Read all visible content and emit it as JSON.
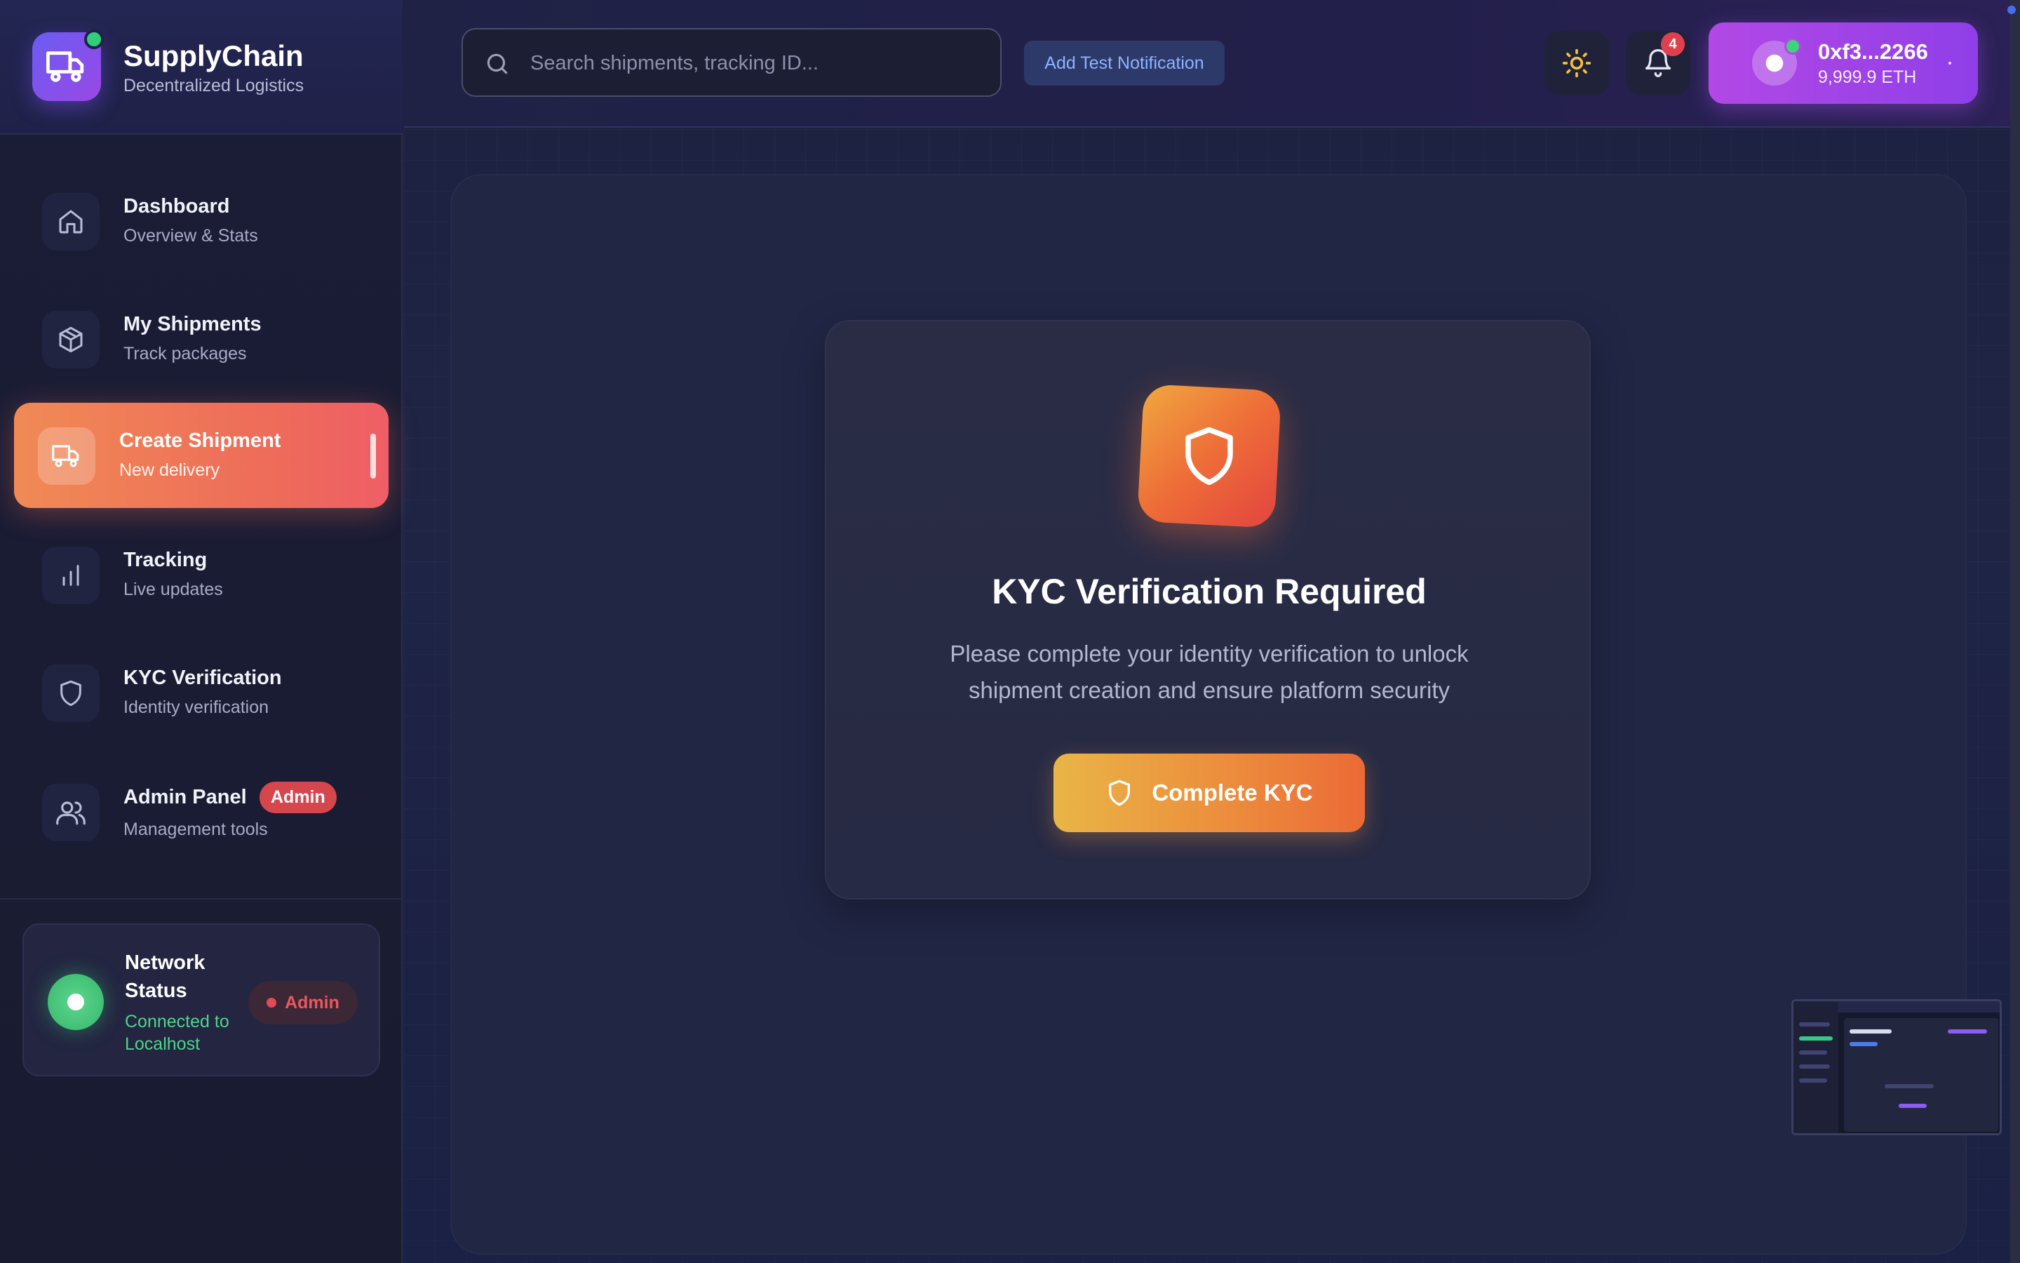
{
  "brand": {
    "name": "SupplyChain",
    "tagline": "Decentralized Logistics"
  },
  "sidebar": {
    "items": [
      {
        "label": "Dashboard",
        "sub": "Overview & Stats",
        "icon": "home-icon"
      },
      {
        "label": "My Shipments",
        "sub": "Track packages",
        "icon": "package-icon"
      },
      {
        "label": "Create Shipment",
        "sub": "New delivery",
        "icon": "truck-icon",
        "active": true
      },
      {
        "label": "Tracking",
        "sub": "Live updates",
        "icon": "bar-chart-icon"
      },
      {
        "label": "KYC Verification",
        "sub": "Identity verification",
        "icon": "shield-icon"
      },
      {
        "label": "Admin Panel",
        "sub": "Management tools",
        "icon": "users-icon",
        "badge": "Admin"
      }
    ]
  },
  "network": {
    "title": "Network Status",
    "status": "Connected to Localhost",
    "badge": "Admin"
  },
  "header": {
    "search_placeholder": "Search shipments, tracking ID...",
    "test_button": "Add Test Notification",
    "notification_count": "4",
    "wallet": {
      "address": "0xf3...2266",
      "balance": "9,999.9 ETH"
    }
  },
  "kyc": {
    "title": "KYC Verification Required",
    "description": "Please complete your identity verification to unlock shipment creation and ensure platform security",
    "button": "Complete KYC"
  },
  "colors": {
    "accent_orange": "#ee6b5a",
    "wallet_purple": "#b248e5",
    "status_green": "#4fd58a",
    "admin_red": "#d6464d"
  }
}
